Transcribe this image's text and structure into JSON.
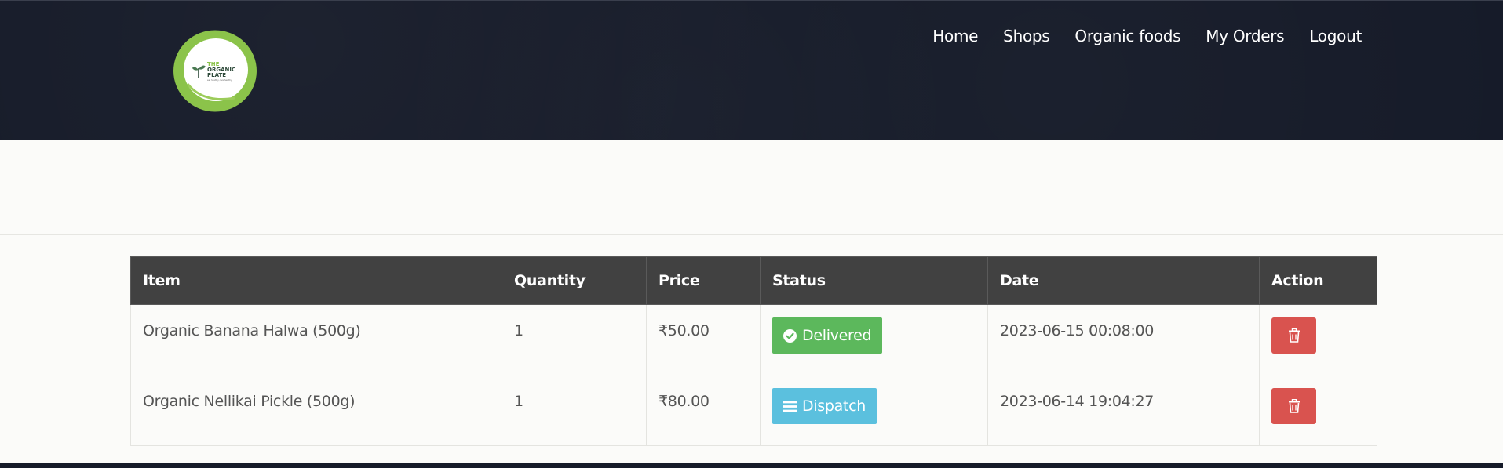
{
  "header": {
    "logo": {
      "line1": "THE",
      "line2": "ORGANIC",
      "line3": "PLATE",
      "tagline": "eat healthy, live healthy"
    },
    "nav": [
      "Home",
      "Shops",
      "Organic foods",
      "My Orders",
      "Logout"
    ]
  },
  "orders_table": {
    "columns": [
      "Item",
      "Quantity",
      "Price",
      "Status",
      "Date",
      "Action"
    ],
    "rows": [
      {
        "item": "Organic Banana Halwa (500g)",
        "quantity": "1",
        "price": "₹50.00",
        "status": "Delivered",
        "status_icon": "check-circle-icon",
        "status_color": "#5cb85c",
        "date": "2023-06-15 00:08:00"
      },
      {
        "item": "Organic Nellikai Pickle (500g)",
        "quantity": "1",
        "price": "₹80.00",
        "status": "Dispatch",
        "status_icon": "bars-icon",
        "status_color": "#5bc0de",
        "date": "2023-06-14 19:04:27"
      }
    ]
  },
  "colors": {
    "header_bg": "#161b29",
    "table_header_bg": "#414141",
    "delete_button": "#d9534f",
    "logo_ring": "#8bc34a"
  }
}
